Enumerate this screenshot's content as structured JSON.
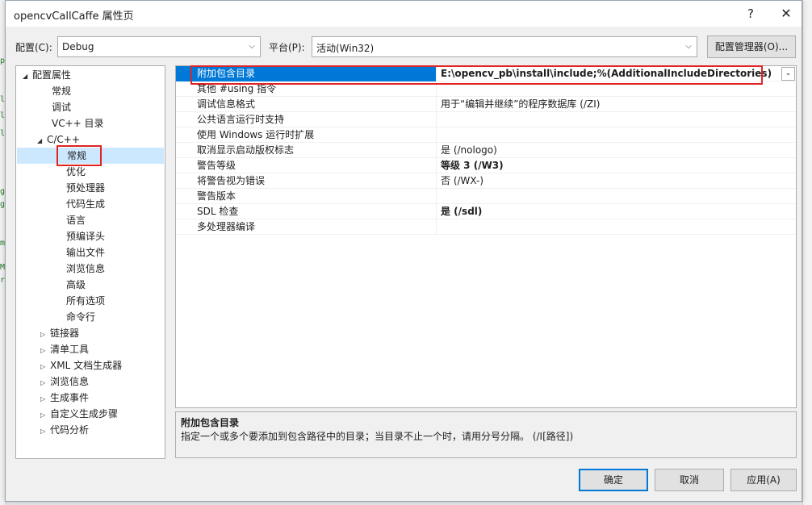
{
  "window": {
    "title": "opencvCallCaffe 属性页",
    "help_glyph": "?",
    "close_glyph": "✕"
  },
  "toolbar": {
    "config_label": "配置(C):",
    "config_value": "Debug",
    "platform_label": "平台(P):",
    "platform_value": "活动(Win32)",
    "config_manager_label": "配置管理器(O)..."
  },
  "tree": {
    "items": [
      {
        "label": "配置属性",
        "expander": "◢"
      },
      {
        "label": "常规"
      },
      {
        "label": "调试"
      },
      {
        "label": "VC++ 目录"
      },
      {
        "label": "C/C++",
        "expander": "◢"
      },
      {
        "label": "常规"
      },
      {
        "label": "优化"
      },
      {
        "label": "预处理器"
      },
      {
        "label": "代码生成"
      },
      {
        "label": "语言"
      },
      {
        "label": "预编译头"
      },
      {
        "label": "输出文件"
      },
      {
        "label": "浏览信息"
      },
      {
        "label": "高级"
      },
      {
        "label": "所有选项"
      },
      {
        "label": "命令行"
      },
      {
        "label": "链接器",
        "expander": "▷"
      },
      {
        "label": "清单工具",
        "expander": "▷"
      },
      {
        "label": "XML 文档生成器",
        "expander": "▷"
      },
      {
        "label": "浏览信息",
        "expander": "▷"
      },
      {
        "label": "生成事件",
        "expander": "▷"
      },
      {
        "label": "自定义生成步骤",
        "expander": "▷"
      },
      {
        "label": "代码分析",
        "expander": "▷"
      }
    ]
  },
  "properties": [
    {
      "name": "附加包含目录",
      "value": "E:\\opencv_pb\\install\\include;%(AdditionalIncludeDirectories)"
    },
    {
      "name": "其他 #using 指令",
      "value": ""
    },
    {
      "name": "调试信息格式",
      "value": "用于“编辑并继续”的程序数据库 (/ZI)"
    },
    {
      "name": "公共语言运行时支持",
      "value": ""
    },
    {
      "name": "使用 Windows 运行时扩展",
      "value": ""
    },
    {
      "name": "取消显示启动版权标志",
      "value": "是 (/nologo)"
    },
    {
      "name": "警告等级",
      "value": "等级 3 (/W3)"
    },
    {
      "name": "将警告视为错误",
      "value": "否 (/WX-)"
    },
    {
      "name": "警告版本",
      "value": ""
    },
    {
      "name": "SDL 检查",
      "value": "是 (/sdl)"
    },
    {
      "name": "多处理器编译",
      "value": ""
    }
  ],
  "description": {
    "title": "附加包含目录",
    "text": "指定一个或多个要添加到包含路径中的目录；当目录不止一个时，请用分号分隔。      (/I[路径])"
  },
  "buttons": {
    "ok": "确定",
    "cancel": "取消",
    "apply": "应用(A)"
  },
  "icons": {
    "dropdown": "chevron-down-icon",
    "combo_arrow": "⌄"
  },
  "colors": {
    "selection": "#0078d7",
    "highlight_box": "#e02424",
    "tree_selection": "#cce8ff"
  }
}
